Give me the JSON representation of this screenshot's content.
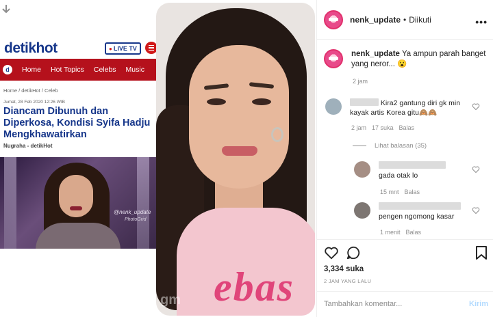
{
  "detik": {
    "logo_detik": "detik",
    "logo_hot": "hot",
    "live_label": "LIVE TV",
    "nav": [
      "Home",
      "Hot Topics",
      "Celebs",
      "Music"
    ],
    "breadcrumb": "Home / detikHot / Celeb",
    "date": "Jumat, 28 Feb 2020 12:26 WIB",
    "title": "Diancam Dibunuh dan Diperkosa, Kondisi Syifa Hadju Mengkhawatirkan",
    "author": "Nugraha - detikHot",
    "photo_watermark": "@nenk_update",
    "photo_watermark2": "PhotoGrid"
  },
  "portrait": {
    "shirt_text": "ebas",
    "watermark": "gm"
  },
  "ig": {
    "header": {
      "username": "nenk_update",
      "separator": "•",
      "follow_status": "Diikuti",
      "more": "•••"
    },
    "caption": {
      "username": "nenk_update",
      "text": "Ya ampun parah banget yang neror... 😮",
      "time": "2 jam"
    },
    "comments": [
      {
        "text": "Kira2 gantung diri gk min kayak artis Korea gitu🙈🙈",
        "time": "2 jam",
        "likes": "17 suka",
        "reply": "Balas"
      }
    ],
    "view_replies": "Lihat balasan (35)",
    "replies": [
      {
        "text": "gada otak lo",
        "time": "15 mnt",
        "reply": "Balas"
      },
      {
        "text": "pengen ngomong kasar",
        "time": "1 menit",
        "reply": "Balas"
      }
    ],
    "likes": "3,334 suka",
    "post_time": "2 JAM YANG LALU",
    "comment_placeholder": "Tambahkan komentar...",
    "post_button": "Kirim"
  },
  "colors": {
    "detik_blue": "#16368a",
    "detik_red": "#b5111c",
    "ig_text": "#262626",
    "ig_muted": "#8e8e8e",
    "ig_post_button": "#b3dbff"
  }
}
